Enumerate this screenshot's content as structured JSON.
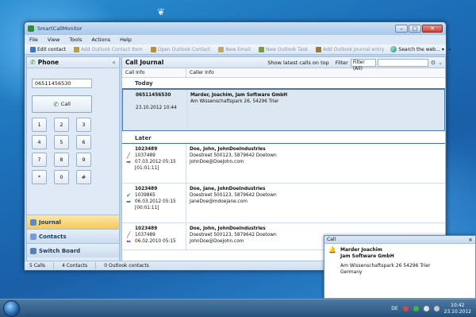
{
  "app": {
    "title": "SmartCallMonitor"
  },
  "menu": [
    "File",
    "View",
    "Tools",
    "Actions",
    "Help"
  ],
  "toolbar": {
    "items": [
      {
        "label": "Edit contact",
        "icon": "edit-contact-icon",
        "color": "#3c76c4",
        "enabled": true
      },
      {
        "label": "Add Outlook Contact Item",
        "icon": "add-outlook-contact-icon",
        "color": "#c29a38",
        "enabled": false
      },
      {
        "label": "Open Outlook Contact",
        "icon": "open-outlook-contact-icon",
        "color": "#b89040",
        "enabled": false
      },
      {
        "label": "New Email",
        "icon": "new-email-icon",
        "color": "#c9a85a",
        "enabled": false
      },
      {
        "label": "New Outlook Task",
        "icon": "new-task-icon",
        "color": "#7a9b4a",
        "enabled": false
      },
      {
        "label": "Add Outlook Journal entry",
        "icon": "journal-entry-icon",
        "color": "#9a7a3a",
        "enabled": false
      }
    ],
    "search_label": "Search the web..."
  },
  "phone": {
    "header": "Phone",
    "collapse": "«",
    "number": "06511456530",
    "call_label": "Call",
    "keys": [
      "1",
      "2",
      "3",
      "4",
      "5",
      "6",
      "7",
      "8",
      "9",
      "*",
      "0",
      "#"
    ]
  },
  "nav": [
    {
      "label": "Journal",
      "active": true
    },
    {
      "label": "Contacts",
      "active": false
    },
    {
      "label": "Switch Board",
      "active": false
    }
  ],
  "journal": {
    "title": "Call Journal",
    "show_latest": "Show latest calls on top",
    "filter_label": "Filter (All)",
    "filter_arrow": "▾",
    "columns": [
      "Call Info",
      "Caller Info"
    ],
    "groups": [
      {
        "label": "Today",
        "rows": [
          {
            "selected": true,
            "status": [],
            "call": [
              "06511456530",
              "",
              "23.10.2012 10:44"
            ],
            "caller": [
              "Marder, Joachim, Jam Software GmbH",
              "Am Wissenschaftspark 26, 54296 Trier"
            ]
          }
        ]
      },
      {
        "label": "Later",
        "rows": [
          {
            "selected": false,
            "status": [
              "red",
              "blue"
            ],
            "call": [
              "1023489",
              "1037489",
              "07.03.2012 05:15",
              "[01:01:11]"
            ],
            "caller": [
              "Doe, John, JohnDoeIndustries",
              "Doestreet 500123, 5879642 Doetown",
              "JohnDoe@DoeJohn.com"
            ]
          },
          {
            "selected": false,
            "status": [
              "green",
              "blue"
            ],
            "call": [
              "1023489",
              "1039865",
              "06.03.2012 05:15",
              "[00:01:11]"
            ],
            "caller": [
              "Doe, Jane, JohnDoeIndustries",
              "Doestreet 500123, 5879642 Doetown",
              "JaneDoe@mdoejane.com"
            ]
          },
          {
            "selected": false,
            "status": [
              "red",
              "purple"
            ],
            "call": [
              "1023489",
              "1037489",
              "06.02.2010 05:15"
            ],
            "caller": [
              "Doe, John, JohnDoeIndustries",
              "Doestreet 500123, 5879642 Doetown",
              "JohnDoe@DoeJohn.com"
            ]
          }
        ]
      }
    ]
  },
  "statusbar": [
    "5 Calls",
    "4 Contacts",
    "0  Outlook contacts"
  ],
  "popup": {
    "title": "Call",
    "close": "×",
    "lines": [
      "Marder Joachim",
      "Jam Software GmbH",
      "",
      "Am Wissenschaftspark 26 54296 Trier",
      "Germany"
    ]
  },
  "taskbar": {
    "language": "DE",
    "time": "10:42",
    "date": "23.10.2012"
  }
}
